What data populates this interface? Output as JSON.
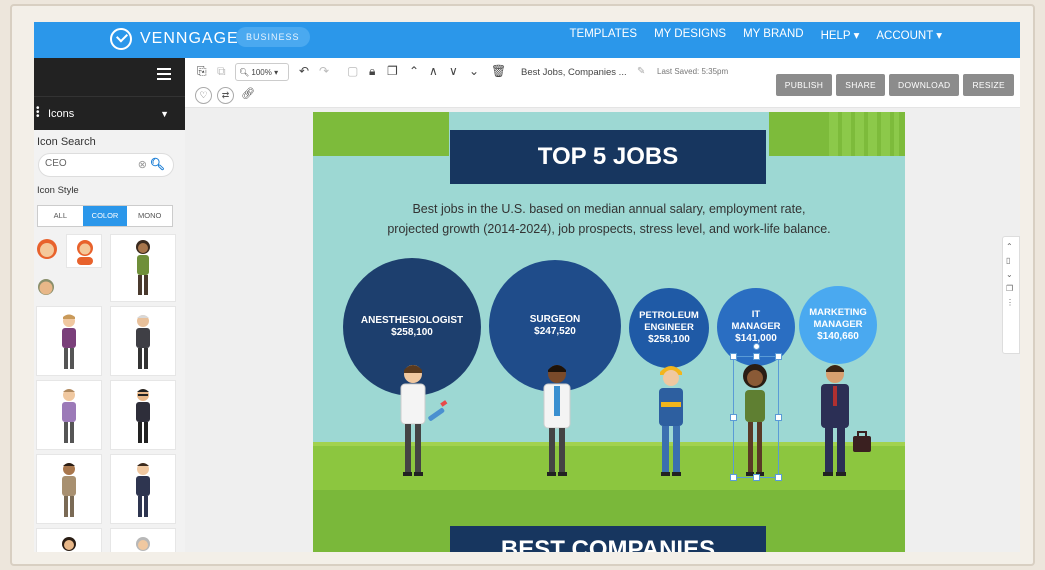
{
  "header": {
    "logo_text": "VENNGAGE",
    "badge": "BUSINESS",
    "nav": [
      "TEMPLATES",
      "MY DESIGNS",
      "MY BRAND",
      "HELP ▾",
      "ACCOUNT ▾"
    ]
  },
  "sidebar": {
    "panel_label": "Icons",
    "icon_search_label": "Icon Search",
    "search_value": "CEO",
    "icon_style_label": "Icon Style",
    "style_tabs": [
      "ALL",
      "COLOR",
      "MONO"
    ],
    "active_style": "COLOR"
  },
  "toolbar": {
    "zoom": "100%",
    "doc_title": "Best Jobs, Companies ...",
    "last_saved": "Last Saved: 5:35pm",
    "buttons": [
      "PUBLISH",
      "SHARE",
      "DOWNLOAD",
      "RESIZE"
    ]
  },
  "infographic": {
    "title": "TOP 5 JOBS",
    "subtitle_line1": "Best jobs in the U.S. based on median annual salary, employment rate,",
    "subtitle_line2": "projected growth (2014-2024), job prospects, stress level, and work-life balance.",
    "jobs": [
      {
        "title": "ANESTHESIOLOGIST",
        "salary": "$258,100"
      },
      {
        "title": "SURGEON",
        "salary": "$247,520"
      },
      {
        "title": "PETROLEUM ENGINEER",
        "salary": "$258,100"
      },
      {
        "title": "IT MANAGER",
        "salary": "$141,000"
      },
      {
        "title": "MARKETING MANAGER",
        "salary": "$140,660"
      }
    ],
    "section2_title": "BEST COMPANIES"
  },
  "colors": {
    "accent": "#2b97ea",
    "navy": "#17365f",
    "bubble_dark": "#1d3f6e",
    "bubble_mid": "#1f5aa6",
    "bubble_light": "#4aa9f0",
    "teal_bg": "#9dd8d3",
    "grass": "#8cc63f"
  }
}
